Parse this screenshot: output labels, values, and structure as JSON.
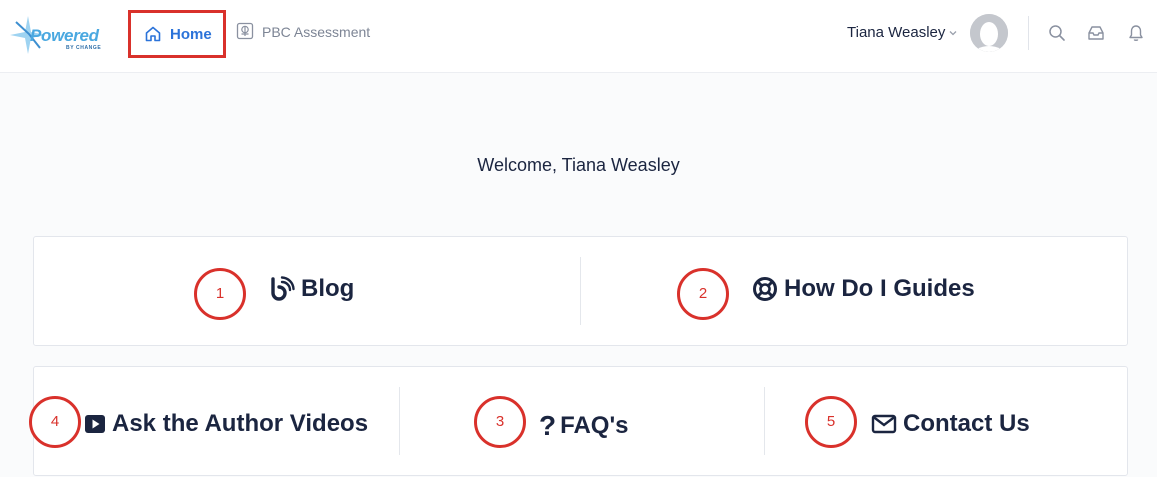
{
  "header": {
    "logo": {
      "word": "Powered",
      "sub": "BY CHANGE"
    },
    "nav": {
      "home_label": "Home",
      "pbc_label": "PBC Assessment"
    },
    "user": {
      "name": "Tiana Weasley"
    },
    "icons": [
      "search-icon",
      "inbox-icon",
      "bell-icon"
    ]
  },
  "main": {
    "welcome": "Welcome, Tiana Weasley",
    "links": {
      "blog": "Blog",
      "guides": "How Do I Guides",
      "videos": "Ask the Author Videos",
      "faq": "FAQ's",
      "contact": "Contact Us"
    }
  },
  "markers": {
    "blog": "1",
    "guides": "2",
    "faq": "3",
    "videos": "4",
    "contact": "5"
  },
  "colors": {
    "accent": "#2b73d9",
    "highlight": "#d9312b",
    "text": "#1b2540"
  }
}
